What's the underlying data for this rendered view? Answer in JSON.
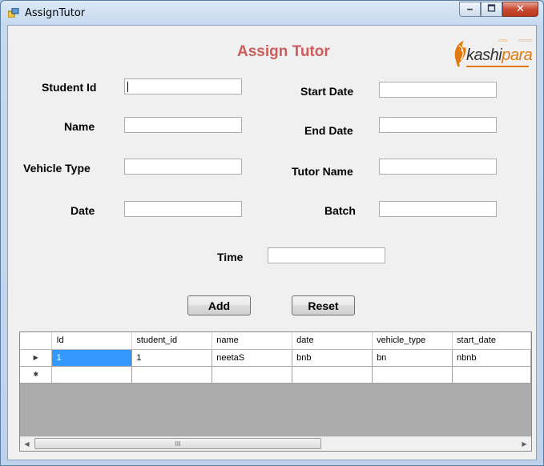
{
  "window": {
    "title": "AssignTutor",
    "min_glyph": "🗕",
    "max_glyph": "🗖",
    "close_glyph": "✕"
  },
  "form": {
    "title": "Assign Tutor",
    "logo": {
      "text_a": "kashi",
      "text_b": "para"
    },
    "labels": {
      "student_id": "Student Id",
      "name": "Name",
      "vehicle_type": "Vehicle Type",
      "date": "Date",
      "start_date": "Start Date",
      "end_date": "End Date",
      "tutor_name": "Tutor Name",
      "batch": "Batch",
      "time": "Time"
    },
    "values": {
      "student_id": "",
      "name": "",
      "vehicle_type": "",
      "date": "",
      "start_date": "",
      "end_date": "",
      "tutor_name": "",
      "batch": "",
      "time": ""
    },
    "buttons": {
      "add": "Add",
      "reset": "Reset"
    }
  },
  "grid": {
    "columns": [
      "Id",
      "student_id",
      "name",
      "date",
      "vehicle_type",
      "start_date"
    ],
    "rows": [
      {
        "marker": "▶",
        "cells": [
          "1",
          "1",
          "neetaS",
          "bnb",
          "bn",
          "nbnb"
        ]
      },
      {
        "marker": "✱",
        "cells": [
          "",
          "",
          "",
          "",
          "",
          ""
        ]
      }
    ],
    "scroll": {
      "left": "◀",
      "right": "▶",
      "thumb_grip": "III"
    }
  },
  "colors": {
    "title_red": "#cd5c5c",
    "logo_orange": "#e07a10",
    "selection_blue": "#3399ff"
  }
}
